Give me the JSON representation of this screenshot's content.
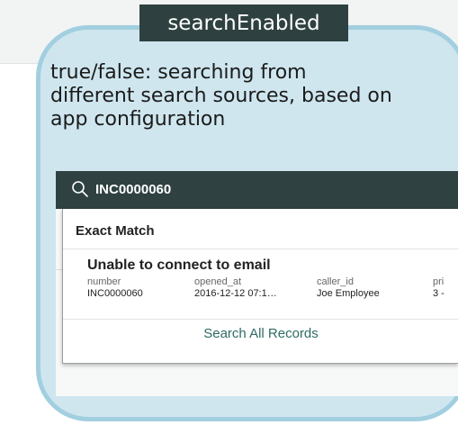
{
  "callout": {
    "title": "searchEnabled",
    "description_lines": [
      "true/false: searching from",
      "different search sources, based on",
      "app configuration"
    ]
  },
  "search": {
    "value": "INC0000060",
    "icon": "search-icon"
  },
  "results": {
    "section_title": "Exact Match",
    "record": {
      "title": "Unable to connect to email",
      "columns": [
        {
          "label": "number",
          "value": "INC0000060"
        },
        {
          "label": "opened_at",
          "value": "2016-12-12 07:1…"
        },
        {
          "label": "caller_id",
          "value": "Joe Employee"
        },
        {
          "label": "pri",
          "value": "3 -"
        }
      ]
    },
    "search_all_label": "Search All Records"
  },
  "colors": {
    "callout_fill": "#cfe6ef",
    "callout_border": "#a2cfe0",
    "dark_header": "#2f4241",
    "link": "#2f6b63"
  }
}
